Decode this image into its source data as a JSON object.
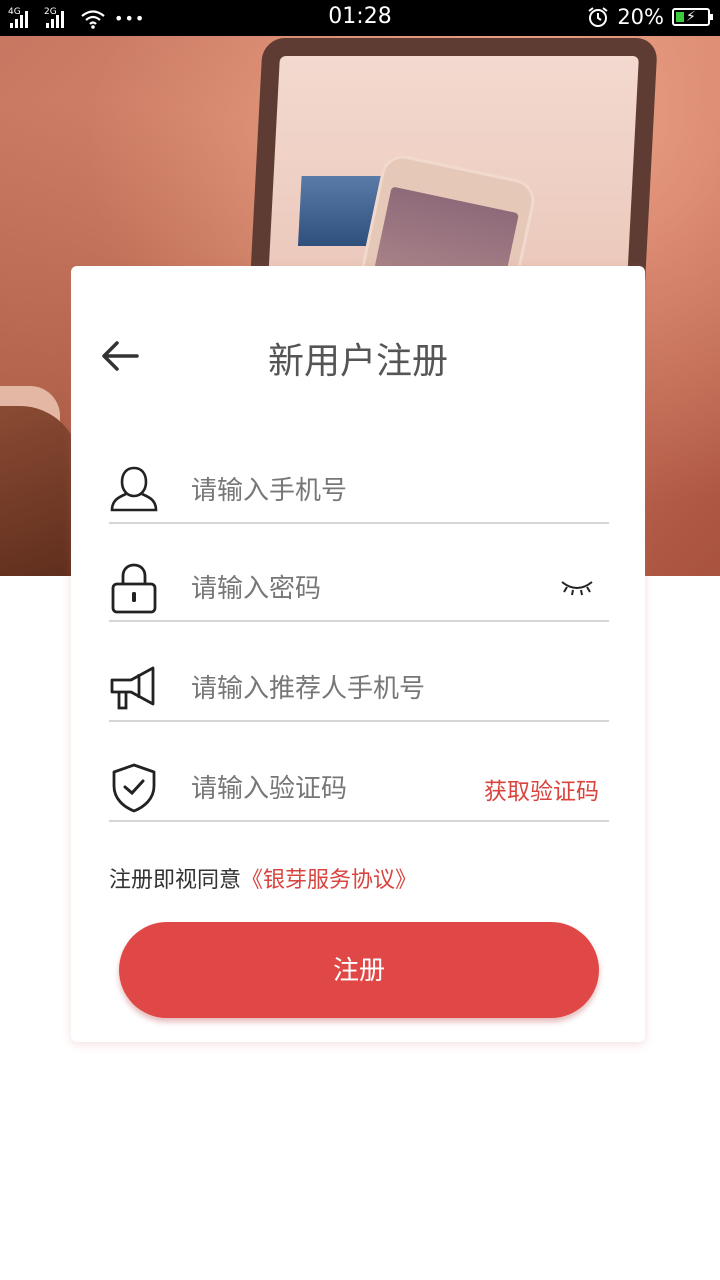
{
  "status_bar": {
    "network1": "4G",
    "network2": "2G",
    "time": "01:28",
    "battery_percent": "20%"
  },
  "page": {
    "title": "新用户注册"
  },
  "form": {
    "phone_placeholder": "请输入手机号",
    "password_placeholder": "请输入密码",
    "referrer_placeholder": "请输入推荐人手机号",
    "code_placeholder": "请输入验证码",
    "get_code_label": "获取验证码"
  },
  "agreement": {
    "prefix": "注册即视同意",
    "link": "《银芽服务协议》"
  },
  "submit_label": "注册",
  "colors": {
    "accent": "#e04848",
    "link": "#d9443e",
    "status_bar": "#000000"
  },
  "icons": [
    "back-arrow-icon",
    "user-icon",
    "lock-icon",
    "eye-closed-icon",
    "megaphone-icon",
    "shield-check-icon",
    "wifi-icon",
    "alarm-icon",
    "battery-icon"
  ]
}
